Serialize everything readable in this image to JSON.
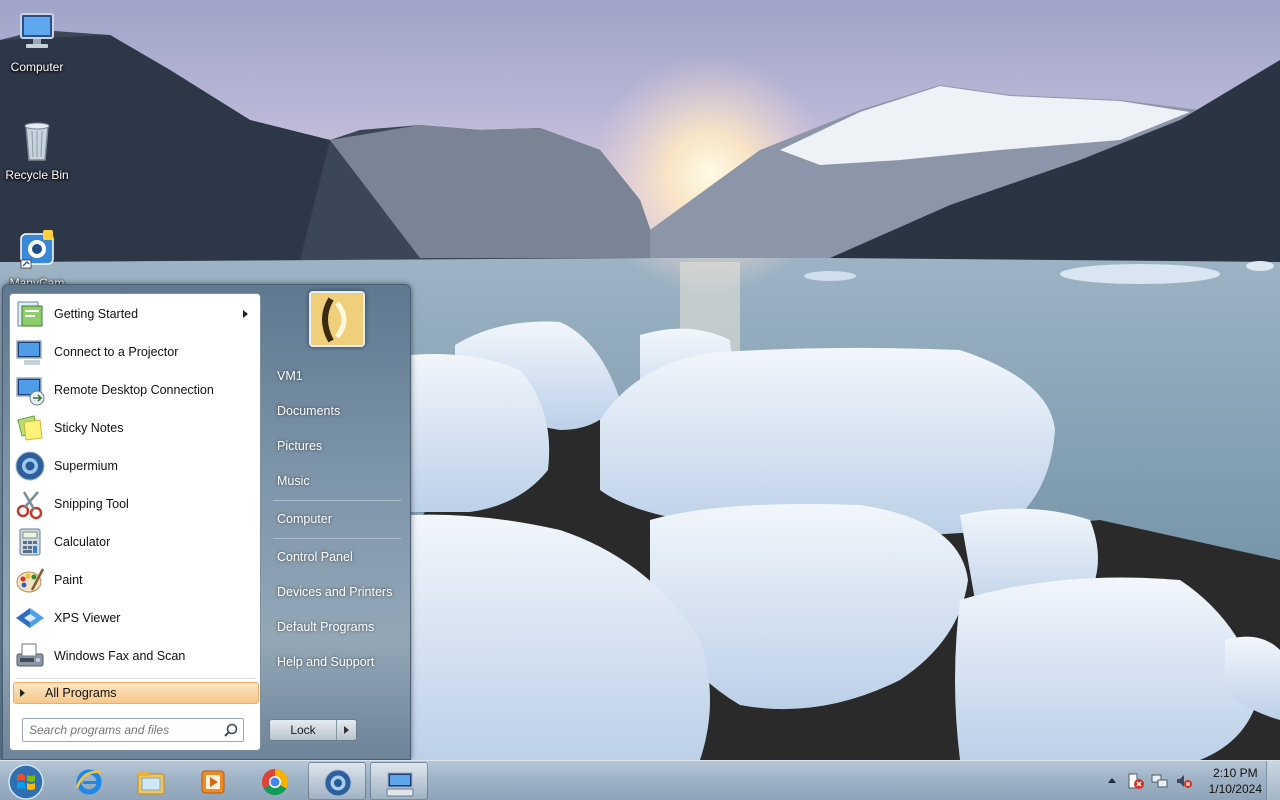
{
  "desktop": {
    "icons": [
      {
        "label": "Computer",
        "icon": "computer-icon"
      },
      {
        "label": "Recycle Bin",
        "icon": "recycle-bin-icon"
      },
      {
        "label": "ManyCam",
        "icon": "manycam-icon"
      }
    ]
  },
  "start_menu": {
    "programs": [
      {
        "label": "Getting Started",
        "icon": "getting-started-icon",
        "has_submenu": true
      },
      {
        "label": "Connect to a Projector",
        "icon": "projector-icon"
      },
      {
        "label": "Remote Desktop Connection",
        "icon": "remote-desktop-icon"
      },
      {
        "label": "Sticky Notes",
        "icon": "sticky-notes-icon"
      },
      {
        "label": "Supermium",
        "icon": "supermium-icon"
      },
      {
        "label": "Snipping Tool",
        "icon": "snipping-tool-icon"
      },
      {
        "label": "Calculator",
        "icon": "calculator-icon"
      },
      {
        "label": "Paint",
        "icon": "paint-icon"
      },
      {
        "label": "XPS Viewer",
        "icon": "xps-viewer-icon"
      },
      {
        "label": "Windows Fax and Scan",
        "icon": "fax-scan-icon"
      }
    ],
    "all_programs": "All Programs",
    "search_placeholder": "Search programs and files",
    "right_links": [
      {
        "label": "VM1"
      },
      {
        "label": "Documents"
      },
      {
        "label": "Pictures"
      },
      {
        "label": "Music"
      },
      {
        "label": "Computer"
      },
      {
        "label": "Control Panel"
      },
      {
        "label": "Devices and Printers"
      },
      {
        "label": "Default Programs"
      },
      {
        "label": "Help and Support"
      }
    ],
    "lock_label": "Lock"
  },
  "taskbar": {
    "pinned": [
      {
        "icon": "internet-explorer-icon"
      },
      {
        "icon": "file-explorer-icon"
      },
      {
        "icon": "media-player-icon"
      },
      {
        "icon": "chrome-icon"
      },
      {
        "icon": "supermium-icon",
        "active": true
      },
      {
        "icon": "keyboard-app-icon",
        "active": true
      }
    ],
    "clock": {
      "time": "2:10 PM",
      "date": "1/10/2024"
    }
  },
  "colors": {
    "start_menu_highlight": "#f6c98c",
    "taskbar": "#9fb3c6"
  }
}
